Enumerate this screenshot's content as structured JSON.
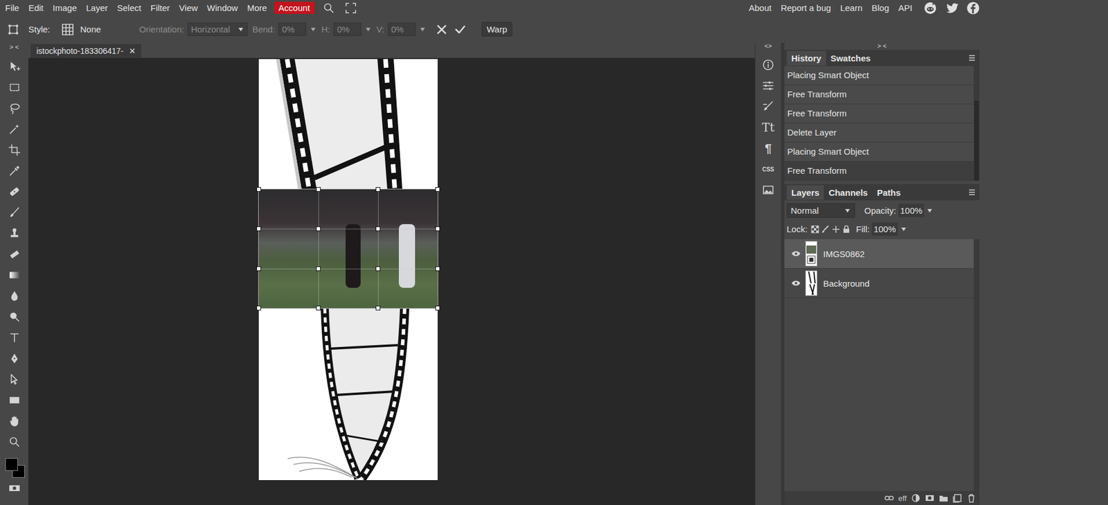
{
  "menu": [
    {
      "label": "File",
      "highlighted": false
    },
    {
      "label": "Edit",
      "highlighted": false
    },
    {
      "label": "Image",
      "highlighted": false
    },
    {
      "label": "Layer",
      "highlighted": false
    },
    {
      "label": "Select",
      "highlighted": false
    },
    {
      "label": "Filter",
      "highlighted": false
    },
    {
      "label": "View",
      "highlighted": false
    },
    {
      "label": "Window",
      "highlighted": false
    },
    {
      "label": "More",
      "highlighted": false
    },
    {
      "label": "Account",
      "highlighted": true
    }
  ],
  "links": [
    "About",
    "Report a bug",
    "Learn",
    "Blog",
    "API"
  ],
  "options": {
    "style_label": "Style:",
    "style_value": "None",
    "fields": [
      {
        "label": "Orientation:",
        "value": "Horizontal",
        "kind": "select",
        "disabled": true
      },
      {
        "label": "Bend:",
        "value": "0%",
        "kind": "percent",
        "disabled": true
      },
      {
        "label": "H:",
        "value": "0%",
        "kind": "percent",
        "disabled": true
      },
      {
        "label": "V:",
        "value": "0%",
        "kind": "percent",
        "disabled": true
      }
    ],
    "warp": "Warp"
  },
  "toolbar": {
    "collapse": "> <"
  },
  "document_tab": {
    "title": "istockphoto-183306417-",
    "close": "×",
    "selected": true
  },
  "side_icons": {
    "collapse": "<>",
    "type": "Tt",
    "paragraph": "¶",
    "css": "CSS"
  },
  "panels_collapse": "> <",
  "history": {
    "tabs": [
      {
        "label": "History",
        "selected": true
      },
      {
        "label": "Swatches",
        "selected": false
      }
    ],
    "items": [
      {
        "label": "Placing Smart Object",
        "selected": false
      },
      {
        "label": "Free Transform",
        "selected": false
      },
      {
        "label": "Free Transform",
        "selected": false
      },
      {
        "label": "Delete Layer",
        "selected": false
      },
      {
        "label": "Placing Smart Object",
        "selected": false
      },
      {
        "label": "Free Transform",
        "selected": true
      }
    ]
  },
  "layers": {
    "tabs": [
      {
        "label": "Layers",
        "selected": true
      },
      {
        "label": "Channels",
        "selected": false
      },
      {
        "label": "Paths",
        "selected": false
      }
    ],
    "blend_mode": "Normal",
    "opacity_label": "Opacity:",
    "opacity": "100%",
    "lock_label": "Lock:",
    "fill_label": "Fill:",
    "fill": "100%",
    "items": [
      {
        "name": "IMGS0862",
        "selected": true,
        "visible": true,
        "kind": "smart"
      },
      {
        "name": "Background",
        "selected": false,
        "visible": true,
        "kind": "image"
      }
    ],
    "footer_effects": "eff"
  }
}
